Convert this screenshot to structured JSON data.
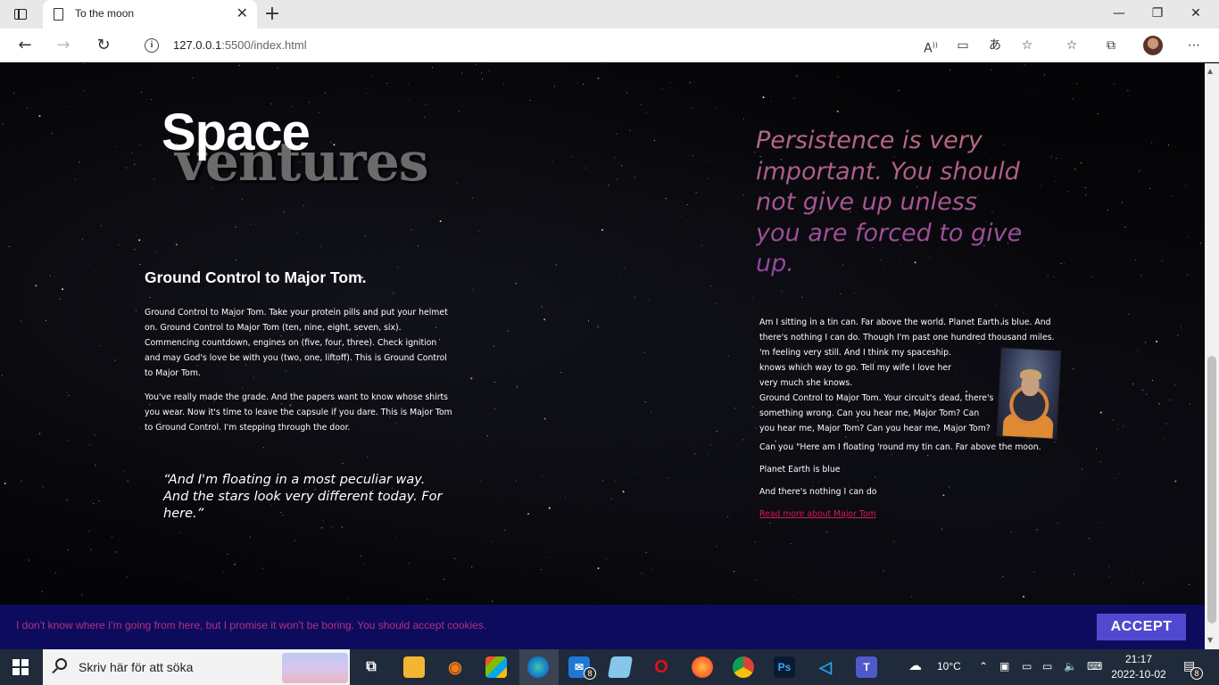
{
  "browser": {
    "tab_title": "To the moon",
    "tab_close": "✕",
    "new_tab": "+",
    "url": "127.0.0.1:5500/index.html",
    "url_host": "127.0.0.1",
    "url_rest": ":5500/index.html",
    "controls": {
      "minimize": "—",
      "maximize": "❐",
      "close": "✕"
    },
    "icons": [
      "read-aloud-icon",
      "app-available-icon",
      "translate-icon",
      "add-favorite-icon",
      "favorites-icon",
      "collections-icon",
      "profile-avatar",
      "more-icon"
    ]
  },
  "page": {
    "logo_top": "Space",
    "logo_bottom": "ventures",
    "quote_right": "Persistence is very important. You should not give up unless you are forced to give up.",
    "heading": "Ground Control to Major Tom.",
    "para1": "Ground Control to Major Tom. Take your protein pills and put your helmet on. Ground Control to Major Tom (ten, nine, eight, seven, six). Commencing countdown, engines on (five, four, three). Check ignition and may God's love be with you (two, one, liftoff). This is Ground Control to Major Tom.",
    "para2": "You've really made the grade. And the papers want to know whose shirts you wear. Now it's time to leave the capsule if you dare. This is Major Tom to Ground Control. I'm stepping through the door.",
    "quote_left": "“And I'm floating in a most peculiar way. And the stars look very different today. For here.”",
    "right_lines": [
      "Am I sitting in a tin can. Far above the world. Planet Earth is blue. And",
      "there's nothing I can do. Though I'm past one hundred thousand miles.",
      "'m feeling very still. And I think my spaceship.",
      "knows which way to go. Tell my wife I love her",
      "very much she knows.",
      "Ground Control to Major Tom. Your circuit's dead, there's",
      "something wrong. Can you hear me, Major Tom? Can",
      "you hear me, Major Tom? Can you hear me, Major Tom?"
    ],
    "right_p1": "Can you \"Here am I floating 'round my tin can. Far above the moon.",
    "right_p2": "Planet Earth is blue",
    "right_p3": "And there's nothing I can do",
    "read_more": "Read more about Major Tom"
  },
  "cookie": {
    "text": "I don't know where I'm going from here, but I promise it won't be boring. You should accept cookies.",
    "button": "ACCEPT"
  },
  "taskbar": {
    "search_placeholder": "Skriv här för att söka",
    "mail_badge": "8",
    "weather": "10°C",
    "time": "21:17",
    "date": "2022-10-02",
    "notification_badge": "8"
  },
  "colors": {
    "quote_gradient_start": "#b96a80",
    "quote_gradient_end": "#8e43a0",
    "link": "#d81a5a",
    "cookie_bg": "#0d0b5e",
    "cookie_text": "#b4307f",
    "cookie_button": "#5049cf"
  }
}
